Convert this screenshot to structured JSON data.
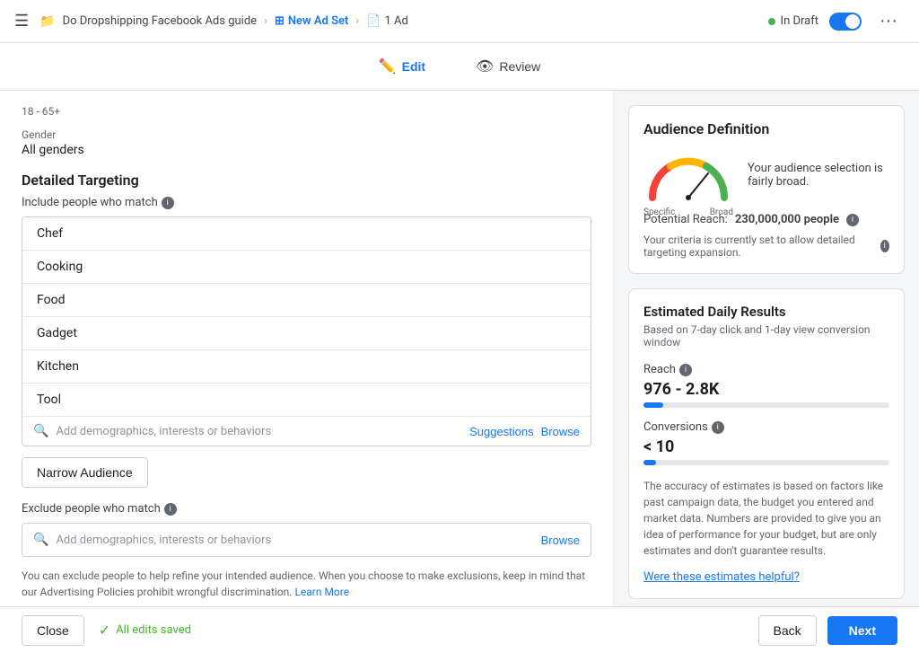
{
  "topbar": {
    "campaign": "Do Dropshipping Facebook Ads guide",
    "adset": "New Ad Set",
    "ad": "1 Ad",
    "status": "In Draft",
    "toggle_on": true
  },
  "tabs": {
    "edit": "Edit",
    "review": "Review"
  },
  "left": {
    "gender_label": "Gender",
    "gender_value": "All genders",
    "detailed_targeting": "Detailed Targeting",
    "include_label": "Include people who match",
    "audience_items": [
      "Chef",
      "Cooking",
      "Food",
      "Gadget",
      "Kitchen",
      "Tool"
    ],
    "search_placeholder": "Add demographics, interests or behaviors",
    "suggestions_link": "Suggestions",
    "browse_link": "Browse",
    "narrow_btn": "Narrow Audience",
    "exclude_label": "Exclude people who match",
    "exclude_placeholder": "Add demographics, interests or behaviors",
    "exclude_browse": "Browse",
    "disclaimer": "You can exclude people to help refine your intended audience. When you choose to make exclusions, keep in mind that our Advertising Policies prohibit wrongful discrimination.",
    "learn_more": "Learn More"
  },
  "right": {
    "audience_def_title": "Audience Definition",
    "gauge_label_specific": "Specific",
    "gauge_label_broad": "Broad",
    "gauge_desc": "Your audience selection is fairly broad.",
    "potential_reach_label": "Potential Reach:",
    "potential_reach_value": "230,000,000 people",
    "criteria_note": "Your criteria is currently set to allow detailed targeting expansion.",
    "estimated_title": "Estimated Daily Results",
    "estimated_subtitle": "Based on 7-day click and 1-day view conversion window",
    "reach_label": "Reach",
    "reach_value": "976 - 2.8K",
    "reach_bar_pct": 8,
    "conversions_label": "Conversions",
    "conversions_value": "< 10",
    "conversions_bar_pct": 5,
    "accuracy_note": "The accuracy of estimates is based on factors like past campaign data, the budget you entered and market data. Numbers are provided to give you an idea of performance for your budget, but are only estimates and don't guarantee results.",
    "helpful_link": "Were these estimates helpful?"
  },
  "bottom": {
    "close": "Close",
    "saved": "All edits saved",
    "back": "Back",
    "next": "Next"
  }
}
